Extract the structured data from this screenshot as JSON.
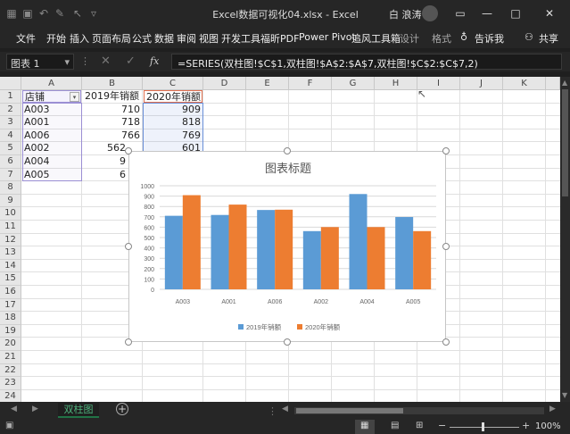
{
  "title": {
    "text": "Excel数据可视化04.xlsx  -  Excel",
    "user": "白 浪涛"
  },
  "window": {
    "minimize": "—",
    "restore": "▭",
    "maximize": "□",
    "close": "✕"
  },
  "ribbon": {
    "tabs": [
      "文件",
      "开始",
      "插入",
      "页面布局",
      "公式",
      "数据",
      "审阅",
      "视图",
      "开发工具",
      "福昕PDF",
      "Power Pivot",
      "追风工具箱",
      "设计",
      "格式"
    ],
    "tell_me": "告诉我",
    "share": "共享"
  },
  "formula_bar": {
    "name_box": "图表 1",
    "fx": "fx",
    "formula": "=SERIES(双柱图!$C$1,双柱图!$A$2:$A$7,双柱图!$C$2:$C$7,2)"
  },
  "columns": [
    "A",
    "B",
    "C",
    "D",
    "E",
    "F",
    "G",
    "H",
    "I",
    "J",
    "K"
  ],
  "rows": [
    "1",
    "2",
    "3",
    "4",
    "5",
    "6",
    "7",
    "8",
    "9",
    "10",
    "11",
    "12",
    "13",
    "14",
    "15",
    "16",
    "17",
    "18",
    "19",
    "20",
    "21",
    "22",
    "23",
    "24"
  ],
  "cells": {
    "header": [
      "店铺",
      "2019年销额",
      "2020年销额"
    ],
    "data": [
      [
        "A003",
        "710",
        "909"
      ],
      [
        "A001",
        "718",
        "818"
      ],
      [
        "A006",
        "766",
        "769"
      ],
      [
        "A002",
        "562",
        "601"
      ],
      [
        "A004",
        "9",
        ""
      ],
      [
        "A005",
        "6",
        ""
      ]
    ]
  },
  "chart_data": {
    "type": "bar",
    "title": "图表标题",
    "categories": [
      "A003",
      "A001",
      "A006",
      "A002",
      "A004",
      "A005"
    ],
    "series": [
      {
        "name": "2019年销额",
        "color": "#5b9bd5",
        "values": [
          710,
          718,
          766,
          562,
          920,
          698
        ]
      },
      {
        "name": "2020年销额",
        "color": "#ed7d31",
        "values": [
          909,
          818,
          769,
          601,
          601,
          562
        ]
      }
    ],
    "yticks": [
      "0",
      "100",
      "200",
      "300",
      "400",
      "500",
      "600",
      "700",
      "800",
      "900",
      "1000"
    ],
    "ylim": [
      0,
      1000
    ],
    "grid": true,
    "legend": "bottom"
  },
  "sheet": {
    "tab": "双柱图",
    "add": "+"
  },
  "status": {
    "zoom": "100%"
  }
}
